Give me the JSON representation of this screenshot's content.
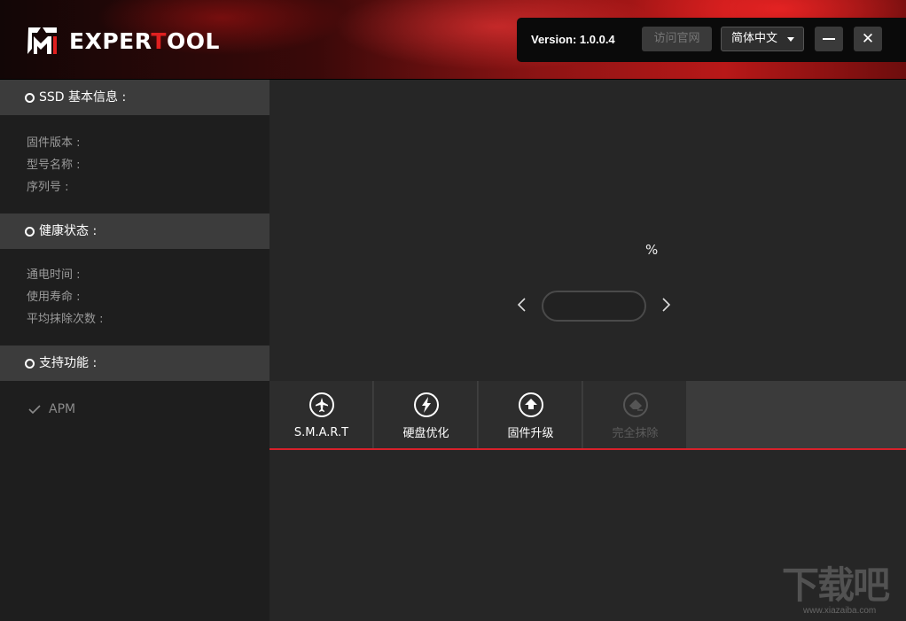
{
  "app": {
    "logo_text_part1": "EXPER",
    "logo_text_accent": "T",
    "logo_text_part2": "OOL",
    "accent_color": "#d8202a"
  },
  "topbar": {
    "version": "Version: 1.0.0.4",
    "visit_site_label": "访问官网",
    "language_selected": "简体中文",
    "minimize_icon": "minimize-icon",
    "close_label": "✕"
  },
  "sidebar": {
    "ssd_info": {
      "title": "SSD 基本信息 :",
      "rows": [
        "固件版本 :",
        "型号名称 :",
        "序列号 :"
      ]
    },
    "health": {
      "title": "健康状态 :",
      "rows": [
        "通电时间 :",
        "使用寿命 :",
        "平均抹除次数 :"
      ]
    },
    "features": {
      "title": "支持功能 :",
      "items": [
        "APM"
      ]
    }
  },
  "display": {
    "percent_symbol": "%"
  },
  "tabs": [
    {
      "label": "S.M.A.R.T",
      "icon": "airplane-icon",
      "enabled": true
    },
    {
      "label": "硬盘优化",
      "icon": "lightning-icon",
      "enabled": true
    },
    {
      "label": "固件升级",
      "icon": "upload-arrow-icon",
      "enabled": true
    },
    {
      "label": "完全抹除",
      "icon": "eraser-icon",
      "enabled": false
    }
  ],
  "watermark": {
    "text": "下载吧",
    "url": "www.xiazaiba.com"
  }
}
